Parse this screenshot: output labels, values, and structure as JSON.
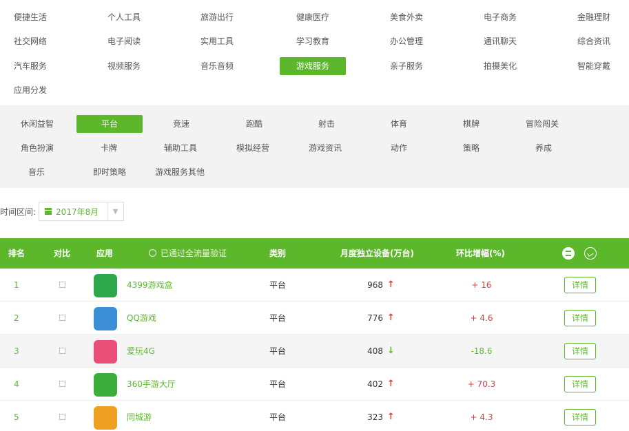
{
  "categories": [
    {
      "label": "便捷生活",
      "active": false
    },
    {
      "label": "个人工具",
      "active": false
    },
    {
      "label": "旅游出行",
      "active": false
    },
    {
      "label": "健康医疗",
      "active": false
    },
    {
      "label": "美食外卖",
      "active": false
    },
    {
      "label": "电子商务",
      "active": false
    },
    {
      "label": "金融理财",
      "active": false
    },
    {
      "label": "社交网络",
      "active": false
    },
    {
      "label": "电子阅读",
      "active": false
    },
    {
      "label": "实用工具",
      "active": false
    },
    {
      "label": "学习教育",
      "active": false
    },
    {
      "label": "办公管理",
      "active": false
    },
    {
      "label": "通讯聊天",
      "active": false
    },
    {
      "label": "综合资讯",
      "active": false
    },
    {
      "label": "汽车服务",
      "active": false
    },
    {
      "label": "视频服务",
      "active": false
    },
    {
      "label": "音乐音频",
      "active": false
    },
    {
      "label": "游戏服务",
      "active": true
    },
    {
      "label": "亲子服务",
      "active": false
    },
    {
      "label": "拍摄美化",
      "active": false
    },
    {
      "label": "智能穿戴",
      "active": false
    },
    {
      "label": "应用分发",
      "active": false
    }
  ],
  "subcategories": [
    {
      "label": "休闲益智",
      "active": false
    },
    {
      "label": "平台",
      "active": true
    },
    {
      "label": "竞速",
      "active": false
    },
    {
      "label": "跑酷",
      "active": false
    },
    {
      "label": "射击",
      "active": false
    },
    {
      "label": "体育",
      "active": false
    },
    {
      "label": "棋牌",
      "active": false
    },
    {
      "label": "冒险闯关",
      "active": false
    },
    {
      "label": "角色扮演",
      "active": false
    },
    {
      "label": "卡牌",
      "active": false
    },
    {
      "label": "辅助工具",
      "active": false
    },
    {
      "label": "模拟经营",
      "active": false
    },
    {
      "label": "游戏资讯",
      "active": false
    },
    {
      "label": "动作",
      "active": false
    },
    {
      "label": "策略",
      "active": false
    },
    {
      "label": "养成",
      "active": false
    },
    {
      "label": "音乐",
      "active": false
    },
    {
      "label": "即时策略",
      "active": false
    },
    {
      "label": "游戏服务其他",
      "active": false
    }
  ],
  "time_filter": {
    "label": "时间区间:",
    "value": "2017年8月",
    "icon": "calendar-icon",
    "caret": "▼"
  },
  "table": {
    "headers": {
      "rank": "排名",
      "compare": "对比",
      "app": "应用",
      "verified": "已通过全流量验证",
      "category": "类别",
      "devices": "月度独立设备(万台)",
      "growth": "环比增幅(%)"
    },
    "header_icons": [
      "list-view-icon",
      "chart-view-icon"
    ],
    "detail_label": "详情",
    "rows": [
      {
        "rank": "1",
        "app": "4399游戏盒",
        "category": "平台",
        "devices": "968",
        "trend": "up",
        "trend_symbol": "↑",
        "growth": "+ 16",
        "growth_dir": "pos",
        "icon": "4399-app-icon",
        "icon_color": "#2ea84a"
      },
      {
        "rank": "2",
        "app": "QQ游戏",
        "category": "平台",
        "devices": "776",
        "trend": "up",
        "trend_symbol": "↑",
        "growth": "+ 4.6",
        "growth_dir": "pos",
        "icon": "qq-game-app-icon",
        "icon_color": "#3d8fd8"
      },
      {
        "rank": "3",
        "app": "爱玩4G",
        "category": "平台",
        "devices": "408",
        "trend": "down",
        "trend_symbol": "↓",
        "growth": "-18.6",
        "growth_dir": "neg",
        "icon": "aiwan-app-icon",
        "icon_color": "#ea4f7a"
      },
      {
        "rank": "4",
        "app": "360手游大厅",
        "category": "平台",
        "devices": "402",
        "trend": "up",
        "trend_symbol": "↑",
        "growth": "+ 70.3",
        "growth_dir": "pos",
        "icon": "360-game-app-icon",
        "icon_color": "#3cae3c"
      },
      {
        "rank": "5",
        "app": "同城游",
        "category": "平台",
        "devices": "323",
        "trend": "up",
        "trend_symbol": "↑",
        "growth": "+ 4.3",
        "growth_dir": "pos",
        "icon": "tongchengyou-app-icon",
        "icon_color": "#f0a020"
      }
    ]
  }
}
